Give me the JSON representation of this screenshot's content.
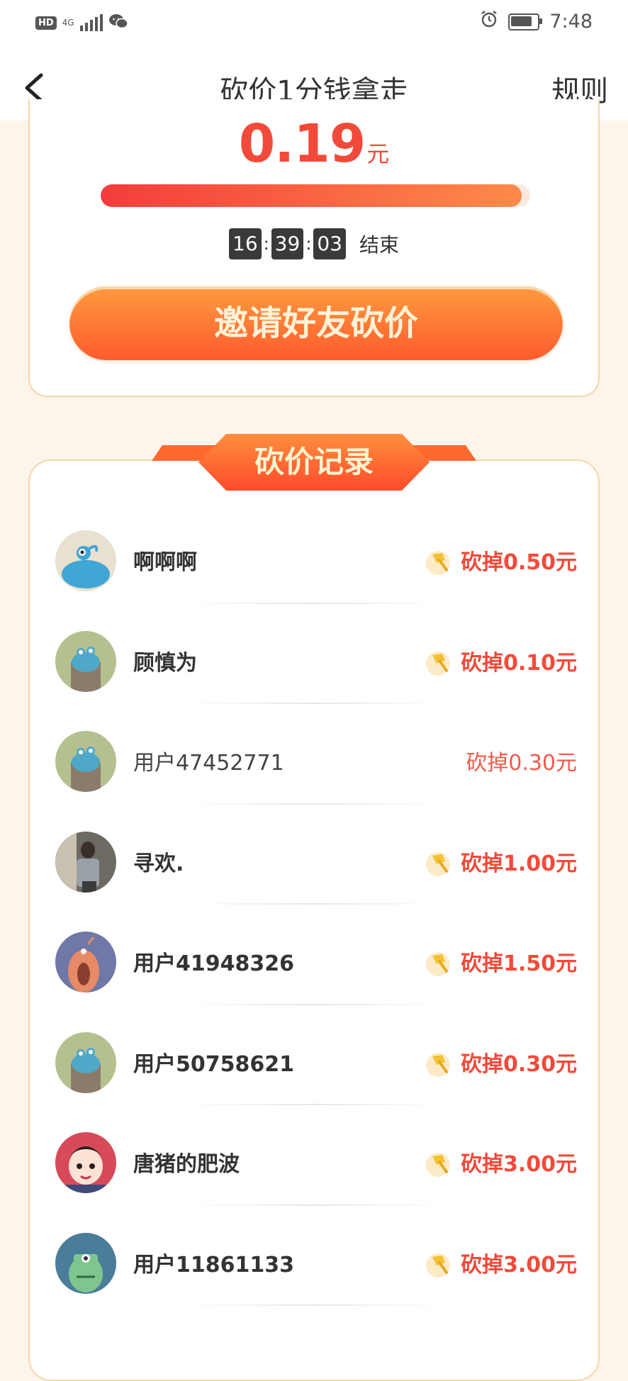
{
  "status_bar": {
    "hd_label": "HD",
    "network": "4G",
    "time": "7:48",
    "battery_level": 0.9,
    "icons": [
      "hd-icon",
      "signal-icon",
      "wechat-icon",
      "alarm-icon",
      "battery-icon"
    ]
  },
  "nav": {
    "back_icon": "chevron-left-icon",
    "title": "砍价1分钱拿走",
    "rule_label": "规则"
  },
  "bargain": {
    "price": "0.19",
    "price_unit": "元",
    "progress_fraction": 0.98,
    "timer": {
      "hours": "16",
      "minutes": "39",
      "seconds": "03",
      "separator": ":",
      "end_label": "结束"
    },
    "invite_button": "邀请好友砍价"
  },
  "records": {
    "title": "砍价记录",
    "items": [
      {
        "name": "啊啊啊",
        "amount": "砍掉0.50元",
        "has_axe_icon": true
      },
      {
        "name": "顾慎为",
        "amount": "砍掉0.10元",
        "has_axe_icon": true
      },
      {
        "name": "用户47452771",
        "amount": "砍掉0.30元",
        "has_axe_icon": false
      },
      {
        "name": "寻欢.",
        "amount": "砍掉1.00元",
        "has_axe_icon": true
      },
      {
        "name": "用户41948326",
        "amount": "砍掉1.50元",
        "has_axe_icon": true
      },
      {
        "name": "用户50758621",
        "amount": "砍掉0.30元",
        "has_axe_icon": true
      },
      {
        "name": "唐猪的肥波",
        "amount": "砍掉3.00元",
        "has_axe_icon": true
      },
      {
        "name": "用户11861133",
        "amount": "砍掉3.00元",
        "has_axe_icon": true
      }
    ]
  },
  "colors": {
    "accent_red": "#f24a3a",
    "button_gradient": [
      "#ff9b3f",
      "#ff5b2e"
    ],
    "card_border": "#f6d6a6",
    "page_bg": "#fdf5ec"
  }
}
